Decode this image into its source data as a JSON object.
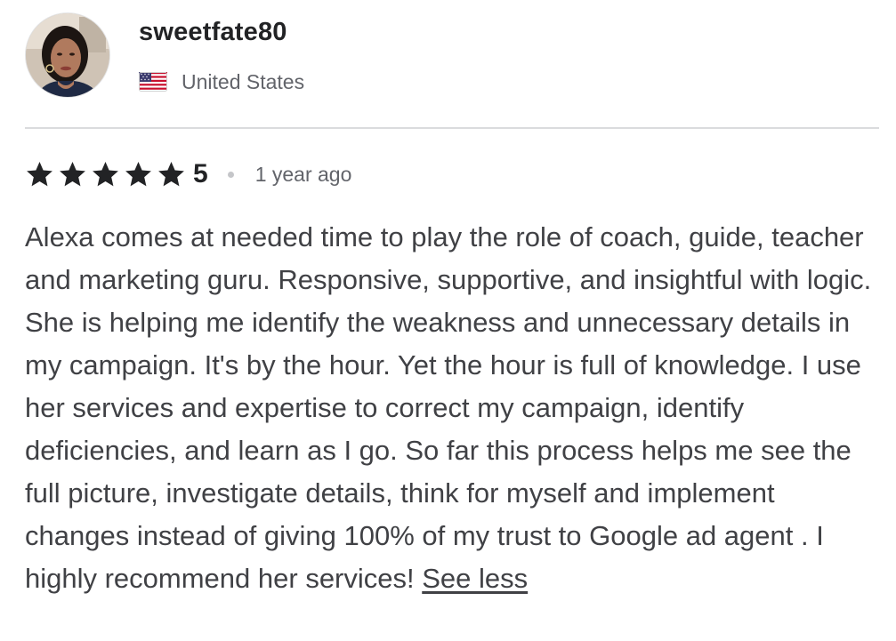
{
  "reviewer": {
    "username": "sweetfate80",
    "country": "United States",
    "flag_icon": "us-flag-icon",
    "avatar_icon": "user-avatar-photo"
  },
  "rating": {
    "value": "5",
    "stars_filled": 5,
    "stars_total": 5,
    "star_color": "#222325",
    "time_ago": "1 year ago"
  },
  "review": {
    "text": "Alexa comes at needed time to play the role of coach, guide, teacher and marketing guru. Responsive, supportive, and insightful with logic. She is helping me identify the weakness and unnecessary details in my campaign. It's by the hour. Yet the hour is full of knowledge. I use her services and expertise to correct my campaign, identify deficiencies, and learn as I go. So far this process helps me see the full picture, investigate details, think for myself and implement changes instead of giving 100% of my trust to Google ad agent . I highly recommend her services!",
    "toggle_label": "See less"
  }
}
